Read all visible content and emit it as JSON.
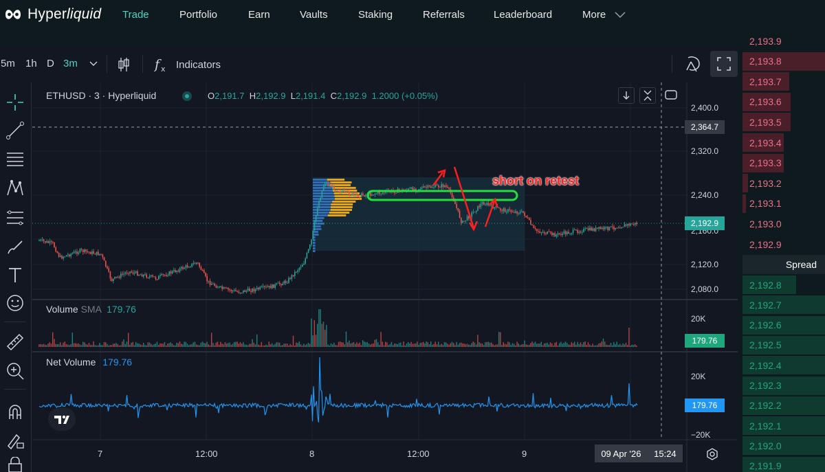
{
  "nav": {
    "logo_prefix": "Hyper",
    "logo_suffix": "liquid",
    "items": [
      {
        "label": "Trade",
        "active": true
      },
      {
        "label": "Portfolio",
        "active": false
      },
      {
        "label": "Earn",
        "active": false
      },
      {
        "label": "Vaults",
        "active": false
      },
      {
        "label": "Staking",
        "active": false
      },
      {
        "label": "Referrals",
        "active": false
      },
      {
        "label": "Leaderboard",
        "active": false
      },
      {
        "label": "More",
        "active": false
      }
    ]
  },
  "toolbar": {
    "intervals": [
      "5m",
      "1h",
      "D",
      "3m"
    ],
    "active_interval": "3m",
    "indicators_label": "Indicators"
  },
  "chart_header": {
    "symbol": "ETHUSD · 3 · Hyperliquid",
    "o_key": "O",
    "o_val": "2,191.7",
    "h_key": "H",
    "h_val": "2,192.9",
    "l_key": "L",
    "l_val": "2,191.4",
    "c_key": "C",
    "c_val": "2,192.9",
    "change": "1.2000 (+0.05%)"
  },
  "price_axis": {
    "ticks": [
      "2,400.0",
      "2,320.0",
      "2,240.0",
      "2,160.0",
      "2,120.0",
      "2,080.0"
    ],
    "crosshair_label": "2,364.7",
    "last_price_label": "2,192.9"
  },
  "annotation": {
    "text": "short on retest"
  },
  "volume_pane": {
    "title": "Volume",
    "sma_label": "SMA",
    "value": "179.76",
    "axis_tick": "20K",
    "tag": "179.76"
  },
  "net_volume_pane": {
    "title": "Net Volume",
    "value": "179.76",
    "axis_top": "20K",
    "axis_bottom": "−20K",
    "tag": "179.76"
  },
  "time_axis": {
    "labels": [
      "7",
      "12:00",
      "8",
      "12:00",
      "9"
    ],
    "cursor_date": "09 Apr '26",
    "cursor_time": "15:24"
  },
  "orderbook": {
    "asks": [
      "2,193.9",
      "2,193.8",
      "2,193.7",
      "2,193.6",
      "2,193.5",
      "2,193.4",
      "2,193.3",
      "2,193.2",
      "2,193.1",
      "2,193.0",
      "2,192.9"
    ],
    "spread_label": "Spread",
    "bids": [
      "2,192.8",
      "2,192.7",
      "2,192.6",
      "2,192.5",
      "2,192.4",
      "2,192.3",
      "2,192.2",
      "2,192.1",
      "2,192.0",
      "2,191.9"
    ]
  },
  "colors": {
    "accent": "#50d2c1",
    "up": "#26a69a",
    "down": "#ef5350",
    "ask_text": "#ed7088",
    "bid_text": "#1fa67d",
    "annotation_red": "#ff1e1e",
    "retest_green": "#22e03a",
    "volume_profile_orange": "#e8a317",
    "volume_profile_blue": "#2f6db5",
    "net_volume_blue": "#2196f3"
  }
}
